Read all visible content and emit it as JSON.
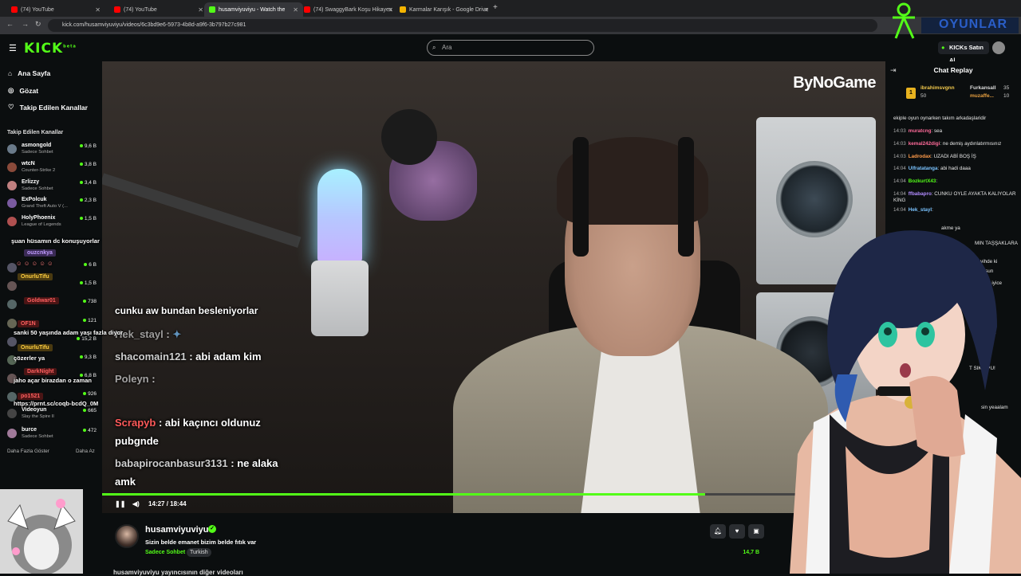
{
  "browser": {
    "tabs": [
      {
        "label": "(74) YouTube",
        "icon": "youtube-icon",
        "active": false
      },
      {
        "label": "(74) YouTube",
        "icon": "youtube-icon",
        "active": false
      },
      {
        "label": "husamviyuviyu - Watch the",
        "icon": "kick-icon",
        "active": true
      },
      {
        "label": "(74) SwaggyBark Koşu Hikayes",
        "icon": "youtube-icon",
        "active": false
      },
      {
        "label": "Karmalar Karışık - Google Drive",
        "icon": "drive-icon",
        "active": false
      }
    ],
    "new_tab": "+",
    "url": "kick.com/husamviyuviyu/videos/6c3bd9e6-5973-4b8d-a9f6-3b797b27c981"
  },
  "header": {
    "logo": "KICK",
    "logo_badge": "beta",
    "search_placeholder": "Ara",
    "buy_kicks": "KICKs Satın Al"
  },
  "sidebar": {
    "nav": [
      {
        "label": "Ana Sayfa",
        "icon": "home-icon"
      },
      {
        "label": "Gözat",
        "icon": "compass-icon"
      },
      {
        "label": "Takip Edilen Kanallar",
        "icon": "heart-icon"
      }
    ],
    "followed_title": "Takip Edilen Kanallar",
    "channels": [
      {
        "name": "asmongold",
        "category": "Sadece Sohbet",
        "viewers": "9,6 B",
        "color": "#6a7a8a"
      },
      {
        "name": "wtcN",
        "category": "Counter-Strike 2",
        "viewers": "3,8 B",
        "color": "#8a4a3a"
      },
      {
        "name": "Erlizzy",
        "category": "Sadece Sohbet",
        "viewers": "3,4 B",
        "color": "#c08080"
      },
      {
        "name": "ExPolcuk",
        "category": "Grand Theft Auto V (...",
        "viewers": "2,3 B",
        "color": "#7a5aa0"
      },
      {
        "name": "HolyPhoenix",
        "category": "League of Legends",
        "viewers": "1,5 B",
        "color": "#b05050"
      },
      {
        "name": "",
        "category": "",
        "viewers": "6 B",
        "color": "#556"
      },
      {
        "name": "",
        "category": "",
        "viewers": "1,5 B",
        "color": "#655"
      },
      {
        "name": "",
        "category": "",
        "viewers": "738",
        "color": "#566"
      },
      {
        "name": "",
        "category": "",
        "viewers": "121",
        "color": "#665"
      },
      {
        "name": "",
        "category": "",
        "viewers": "15,2 B",
        "color": "#556"
      },
      {
        "name": "",
        "category": "",
        "viewers": "9,3 B",
        "color": "#565"
      },
      {
        "name": "",
        "category": "",
        "viewers": "6,8 B",
        "color": "#655"
      },
      {
        "name": "",
        "category": "",
        "viewers": "926",
        "color": "#566"
      },
      {
        "name": "Videoyun",
        "category": "Slay the Spire II",
        "viewers": "665",
        "color": "#444"
      },
      {
        "name": "burce",
        "category": "Sadece Sohbet",
        "viewers": "472",
        "color": "#a07a9a"
      }
    ],
    "show_more": "Daha Fazla Göster",
    "show_less": "Daha Az"
  },
  "side_overlay_chat": [
    "şuan hüsamın dc konuşuyorlar",
    "ouzcnkya",
    "OnurluTifu",
    "Goldwar01",
    "OF1N",
    "sanki 50 yaşında adam yaşı fazla diyor",
    "OnurluTifu",
    "çözerler ya",
    "DarkNight",
    "jaho açar birazdan o zaman",
    "po1521",
    "https://prnt.sc/coqb-bcdQ_0M"
  ],
  "video": {
    "watermark": "ByNoGame",
    "overlay_chat": [
      {
        "user": "",
        "text": "cunku aw bundan besleniyorlar"
      },
      {
        "user": "Hek_stayl",
        "text": ":"
      },
      {
        "user": "shacomain121",
        "text": ": abi adam kim"
      },
      {
        "user": "Poleyn",
        "text": ":"
      },
      {
        "user": "Scrapyb",
        "text": ": abi kaçıncı oldunuz"
      },
      {
        "user": "",
        "text": "pubgnde"
      },
      {
        "user": "babapirocanbasur3131",
        "text": ": ne alaka"
      },
      {
        "user": "",
        "text": "amk"
      }
    ],
    "time_current": "14:27",
    "time_total": "18:44",
    "progress": 0.77
  },
  "streamer": {
    "name": "husamviyuviyu",
    "title": "Sizin belde emanet bizim belde fıtık var",
    "category": "Sadece Sohbet",
    "language": "Turkish",
    "views": "14,7 B",
    "more_videos": "husamviyuviyu yayıncısının diğer videoları"
  },
  "chat": {
    "title": "Chat Replay",
    "leaderboard": [
      {
        "user": "ibrahimsvgnn",
        "value": "50"
      },
      {
        "user": "Furkansall",
        "value": "35"
      },
      {
        "user": "muzaffe...",
        "value": "10"
      }
    ],
    "messages": [
      {
        "time": "",
        "user": "",
        "color": "#fff",
        "text": "ekiple oyun oynarken takım arkadaşlaridir"
      },
      {
        "time": "14:03",
        "user": "muratcng",
        "color": "#ff6b9a",
        "text": ": sea"
      },
      {
        "time": "14:03",
        "user": "kemal242digi",
        "color": "#ff6b9a",
        "text": ": ne demiş aydınlatırmısınız"
      },
      {
        "time": "14:03",
        "user": "Ladrodax",
        "color": "#ff9b4a",
        "text": ": UZADI ABİ BOŞ İŞ"
      },
      {
        "time": "14:04",
        "user": "Ulfratatanga",
        "color": "#7ac3ff",
        "text": ": abi hadi daaa"
      },
      {
        "time": "14:04",
        "user": "BozkurtX43",
        "color": "#53fc18",
        "text": ":"
      },
      {
        "time": "14:04",
        "user": "ffbabapro",
        "color": "#b28cff",
        "text": ": CUNKU OYLE AYAKTA KALIYOLAR KİNG"
      },
      {
        "time": "14:04",
        "user": "Hek_stayl",
        "color": "#7ac3ff",
        "text": ":"
      },
      {
        "time": "",
        "user": "",
        "color": "#fff",
        "text": "akme ya"
      },
      {
        "time": "",
        "user": "",
        "color": "#fff",
        "text": "MIN TAŞŞAKLARA"
      },
      {
        "time": "",
        "user": "",
        "color": "#fff",
        "text": "eravihde ki"
      },
      {
        "time": "",
        "user": "",
        "color": "#fff",
        "text": "uyosun"
      },
      {
        "time": "",
        "user": "",
        "color": "#fff",
        "text": "ya iyice"
      },
      {
        "time": "",
        "user": "",
        "color": "#fff",
        "text": "rsin ya"
      },
      {
        "time": "",
        "user": "",
        "color": "#fff",
        "text": "T SIKO PU!"
      },
      {
        "time": "",
        "user": "",
        "color": "#fff",
        "text": "sin yeaalam"
      }
    ]
  },
  "channel_overlay": {
    "brand": "OYUNLAR",
    "icon": "figure-logo-icon"
  }
}
